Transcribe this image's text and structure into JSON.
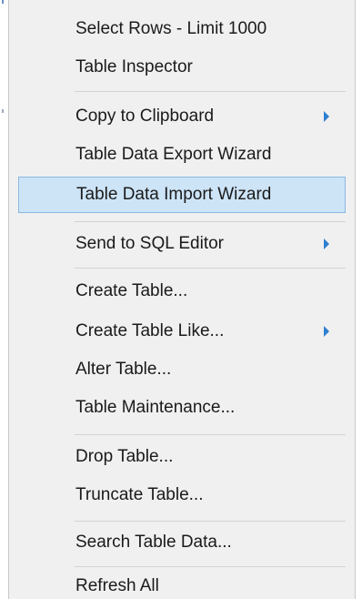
{
  "menu": {
    "items": [
      {
        "label": "Select Rows - Limit 1000",
        "submenu": false
      },
      {
        "label": "Table Inspector",
        "submenu": false
      },
      {
        "label": "Copy to Clipboard",
        "submenu": true
      },
      {
        "label": "Table Data Export Wizard",
        "submenu": false
      },
      {
        "label": "Table Data Import Wizard",
        "submenu": false,
        "highlighted": true
      },
      {
        "label": "Send to SQL Editor",
        "submenu": true
      },
      {
        "label": "Create Table...",
        "submenu": false
      },
      {
        "label": "Create Table Like...",
        "submenu": true
      },
      {
        "label": "Alter Table...",
        "submenu": false
      },
      {
        "label": "Table Maintenance...",
        "submenu": false
      },
      {
        "label": "Drop Table...",
        "submenu": false
      },
      {
        "label": "Truncate Table...",
        "submenu": false
      },
      {
        "label": "Search Table Data...",
        "submenu": false
      },
      {
        "label": "Refresh All",
        "submenu": false
      }
    ]
  },
  "colors": {
    "highlight_bg": "#cde4f7",
    "highlight_border": "#8ab7e0",
    "arrow": "#2e7fd0",
    "menu_bg": "#f0f0f0"
  },
  "icons": {
    "submenu_arrow": "triangle-right-icon"
  }
}
